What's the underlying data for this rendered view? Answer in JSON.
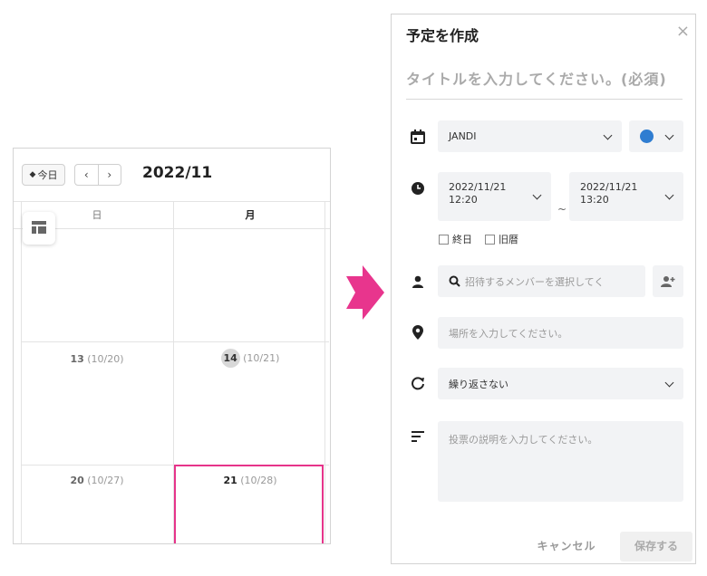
{
  "calendar": {
    "today_label": "今日",
    "prev_label": "‹",
    "next_label": "›",
    "month_title": "2022/11",
    "weekdays": [
      "日",
      "月"
    ],
    "days": [
      {
        "num": "13",
        "lunar": "(10/20)"
      },
      {
        "num": "14",
        "lunar": "(10/21)"
      },
      {
        "num": "20",
        "lunar": "(10/27)"
      },
      {
        "num": "21",
        "lunar": "(10/28)"
      }
    ],
    "highlight_color": "#e6348a"
  },
  "modal": {
    "title": "予定を作成",
    "close": "×",
    "title_placeholder": "タイトルを入力してください。(必須)",
    "calendar_select": "JANDI",
    "color_dot": "#2f7dd1",
    "start_date": "2022/11/21",
    "start_time": "12:20",
    "tilde": "~",
    "end_date": "2022/11/21",
    "end_time": "13:20",
    "all_day": "終日",
    "lunar": "旧暦",
    "member_placeholder": "招待するメンバーを選択してく",
    "location_placeholder": "場所を入力してください。",
    "repeat": "繰り返さない",
    "description_placeholder": "投票の説明を入力してください。",
    "cancel": "キャンセル",
    "save": "保存する"
  },
  "colors": {
    "arrow": "#e8358d"
  }
}
